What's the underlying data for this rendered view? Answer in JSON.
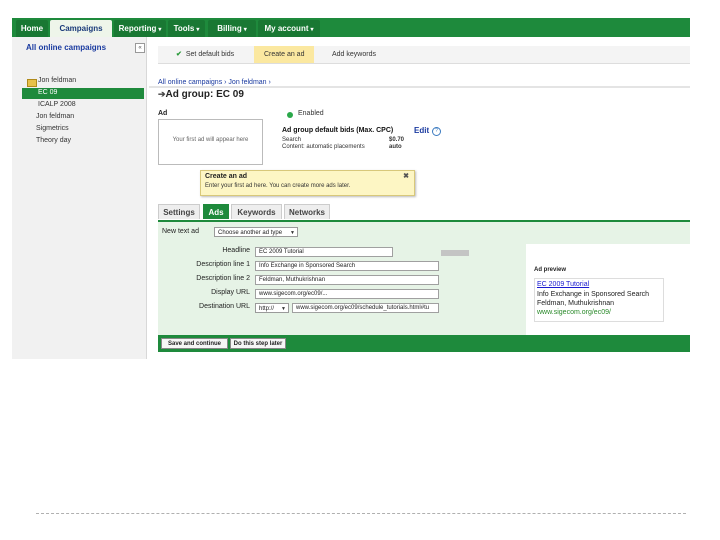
{
  "nav": {
    "tabs": [
      {
        "label": "Home",
        "caret": ""
      },
      {
        "label": "Campaigns",
        "caret": ""
      },
      {
        "label": "Reporting",
        "caret": "▾"
      },
      {
        "label": "Tools",
        "caret": "▾"
      },
      {
        "label": "Billing",
        "caret": "▾"
      },
      {
        "label": "My account",
        "caret": "▾"
      }
    ]
  },
  "sidebar": {
    "heading": "All online campaigns",
    "collapse": "«",
    "items": [
      {
        "label": "Jon feldman"
      },
      {
        "label": "EC 09"
      },
      {
        "label": "ICALP 2008"
      },
      {
        "label": "Jon feldman"
      },
      {
        "label": "Sigmetrics"
      },
      {
        "label": "Theory day"
      }
    ]
  },
  "wizard": {
    "steps": [
      {
        "label": "Set default bids",
        "check": "✔"
      },
      {
        "label": "Create an ad"
      },
      {
        "label": "Add keywords"
      }
    ]
  },
  "breadcrumb": "All online campaigns › Jon feldman ›",
  "adgroup": {
    "arrow": "➔",
    "title": "Ad group: EC 09"
  },
  "ad": {
    "label": "Ad",
    "placeholder": "Your first ad will appear here"
  },
  "status": {
    "text": "Enabled"
  },
  "bids": {
    "title": "Ad group default bids (Max. CPC)",
    "edit": "Edit",
    "help": "?",
    "rows": [
      {
        "label": "Search",
        "value": "$0.70"
      },
      {
        "label": "Content: automatic placements",
        "value": "auto"
      }
    ]
  },
  "tooltip": {
    "title": "Create an ad",
    "body": "Enter your first ad here. You can create more ads later.",
    "close": "✖"
  },
  "tabs": [
    {
      "label": "Settings"
    },
    {
      "label": "Ads"
    },
    {
      "label": "Keywords"
    },
    {
      "label": "Networks"
    }
  ],
  "form": {
    "new_text_ad_label": "New text ad",
    "ad_type_select": "Choose another ad type",
    "fields": [
      {
        "label": "Headline",
        "value": "EC 2009 Tutorial"
      },
      {
        "label": "Description line 1",
        "value": "Info Exchange in Sponsored Search"
      },
      {
        "label": "Description line 2",
        "value": "Feldman, Muthukrishnan"
      },
      {
        "label": "Display URL",
        "value": "www.sigecom.org/ec09/..."
      },
      {
        "label": "Destination URL",
        "protocol": "http://",
        "value": "www.sigecom.org/ec09/schedule_tutorials.html#tu"
      }
    ]
  },
  "preview": {
    "title": "Ad preview",
    "headline": "EC 2009 Tutorial",
    "line1": "Info Exchange in Sponsored Search",
    "line2": "Feldman, Muthukrishnan",
    "url": "www.sigecom.org/ec09/"
  },
  "buttons": {
    "save": "Save and continue",
    "later": "Do this step later"
  }
}
